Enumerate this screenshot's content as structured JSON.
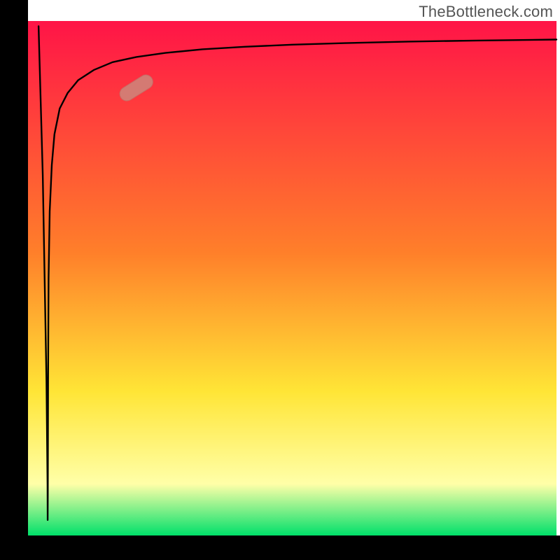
{
  "attribution": "TheBottleneck.com",
  "colors": {
    "frame": "#000000",
    "curve": "#000000",
    "marker_fill": "#c98f82",
    "marker_stroke": "#b77e71",
    "grad_top": "#ff1447",
    "grad_mid1": "#ff7f2a",
    "grad_mid2": "#ffe536",
    "grad_low": "#ffffa8",
    "grad_bottom": "#00e06a"
  },
  "chart_data": {
    "type": "line",
    "title": "",
    "xlabel": "",
    "ylabel": "",
    "xlim": [
      0,
      100
    ],
    "ylim": [
      0,
      100
    ],
    "series": [
      {
        "name": "bottleneck-curve",
        "x": [
          2.0,
          2.8,
          3.5,
          3.7,
          3.72,
          3.75,
          3.8,
          3.9,
          4.1,
          4.5,
          5.0,
          6.0,
          7.5,
          9.5,
          12.5,
          16.0,
          20.5,
          26.0,
          33.0,
          41.0,
          50.0,
          60.0,
          72.0,
          85.0,
          100.0
        ],
        "y": [
          99.0,
          70.0,
          30.0,
          10.0,
          3.0,
          8.0,
          30.0,
          50.0,
          63.0,
          72.0,
          78.0,
          83.0,
          86.0,
          88.5,
          90.5,
          92.0,
          93.0,
          93.8,
          94.5,
          95.0,
          95.4,
          95.7,
          96.0,
          96.2,
          96.4
        ]
      }
    ],
    "marker": {
      "x": 20.5,
      "y": 87.0,
      "angle_deg": -32
    }
  }
}
